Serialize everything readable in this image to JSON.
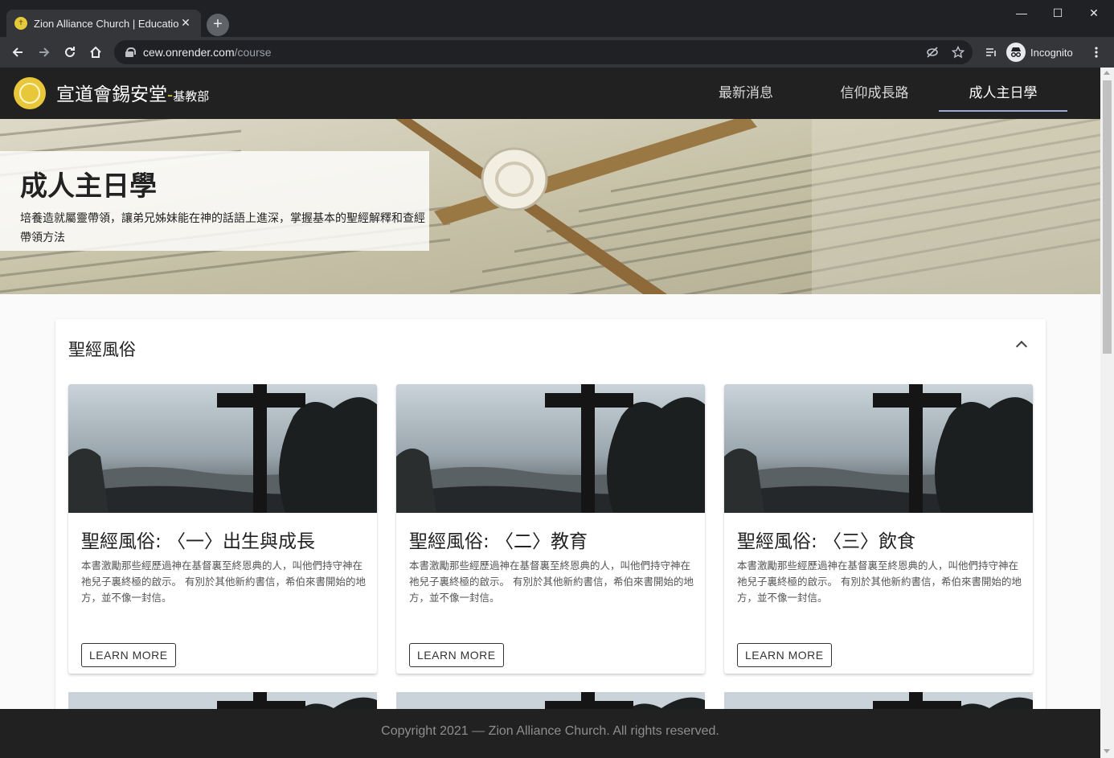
{
  "browser": {
    "tab_title": "Zion Alliance Church | Education",
    "tab_close": "✕",
    "new_tab": "+",
    "url_host": "cew.onrender.com",
    "url_path": "/course",
    "profile_label": "Incognito",
    "window_controls": [
      "—",
      "☐",
      "✕"
    ]
  },
  "site": {
    "name": "宣道會錫安堂",
    "dash": "-",
    "subtitle": "基教部",
    "nav": [
      {
        "label": "最新消息",
        "active": false
      },
      {
        "label": "信仰成長路",
        "active": false
      },
      {
        "label": "成人主日學",
        "active": true
      }
    ]
  },
  "hero": {
    "title": "成人主日學",
    "description": "培養造就屬靈帶領，讓弟兄姊妹能在神的話語上進深，掌握基本的聖經解釋和查經帶領方法"
  },
  "section": {
    "title": "聖經風俗",
    "collapse_icon": "chevron-up-icon",
    "cards": [
      {
        "title": "聖經風俗: 〈一〉出生與成長",
        "text": "本書激勵那些經歷過神在基督裏至終恩典的人，叫他們持守神在祂兒子裏終極的啟示。 有別於其他新約書信，希伯來書開始的地方，並不像一封信。",
        "button": "LEARN MORE"
      },
      {
        "title": "聖經風俗: 〈二〉教育",
        "text": "本書激勵那些經歷過神在基督裏至終恩典的人，叫他們持守神在祂兒子裏終極的啟示。 有別於其他新約書信，希伯來書開始的地方，並不像一封信。",
        "button": "LEARN MORE"
      },
      {
        "title": "聖經風俗: 〈三〉飲食",
        "text": "本書激勵那些經歷過神在基督裏至終恩典的人，叫他們持守神在祂兒子裏終極的啟示。 有別於其他新約書信，希伯來書開始的地方，並不像一封信。",
        "button": "LEARN MORE"
      }
    ]
  },
  "footer": {
    "text": "Copyright 2021 — Zion Alliance Church. All rights reserved."
  },
  "colors": {
    "nav_bg": "#212121",
    "accent": "#e8c83a",
    "active_underline": "#9fa8da"
  }
}
